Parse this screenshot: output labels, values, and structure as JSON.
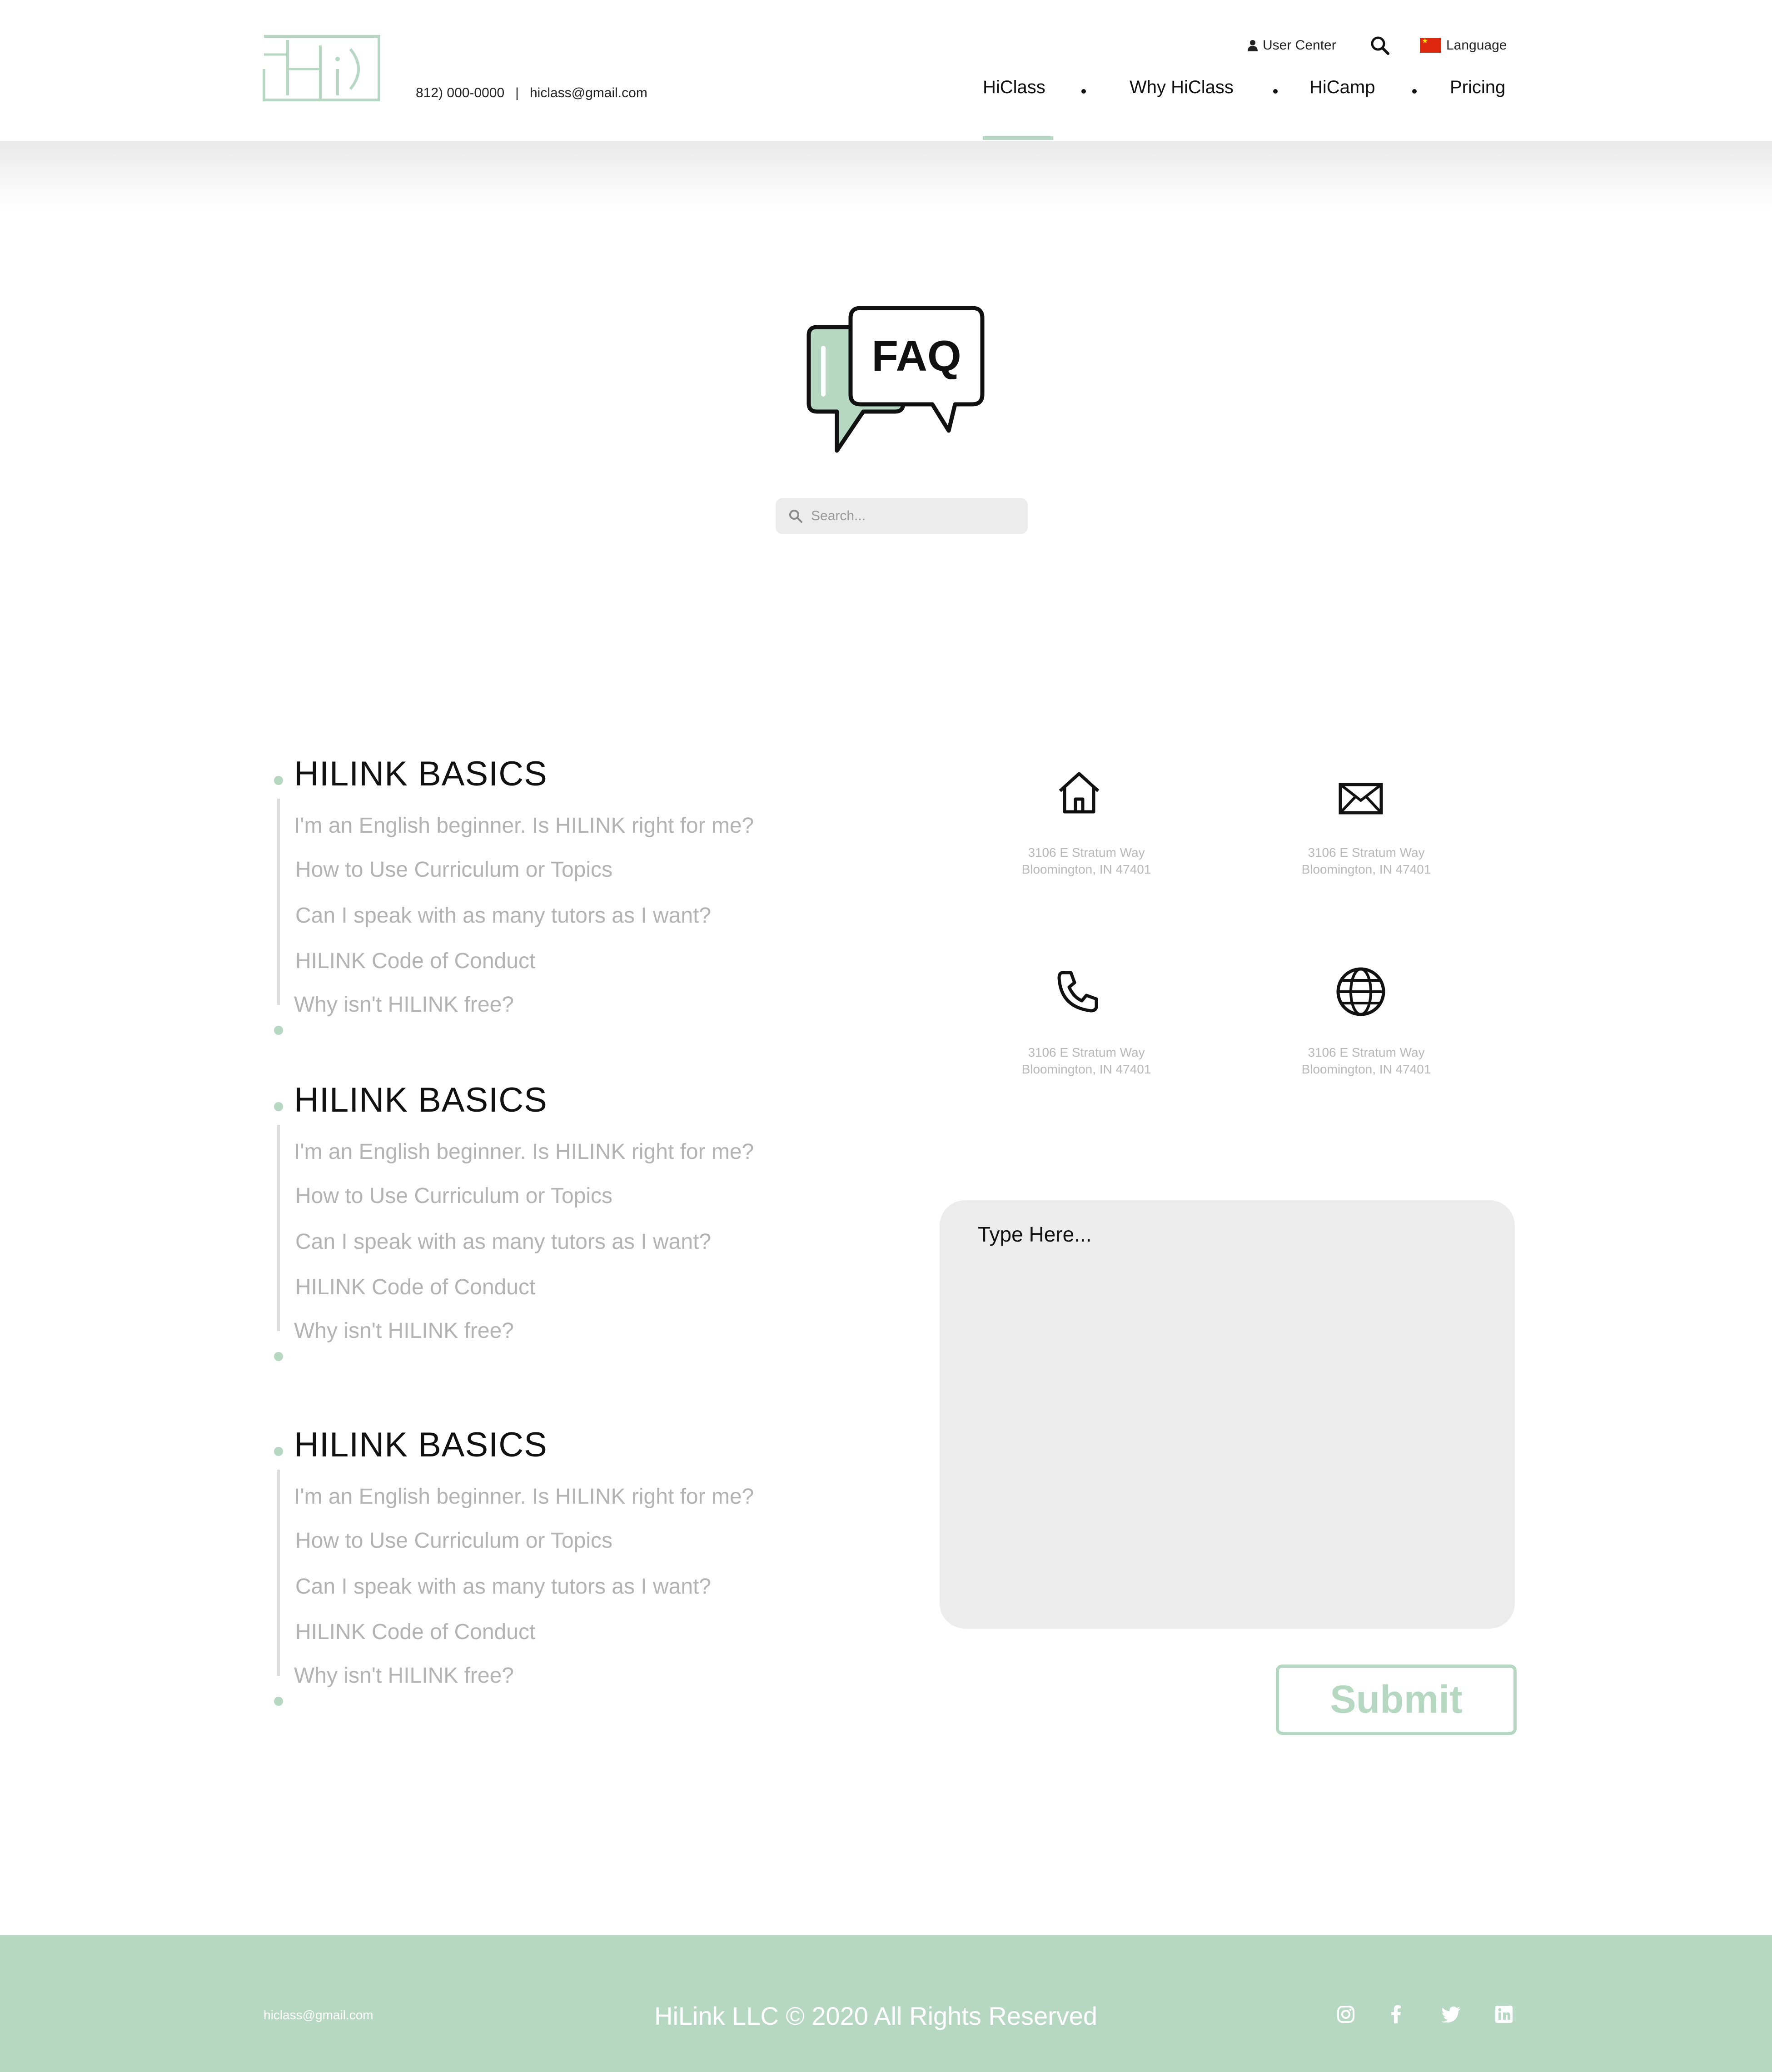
{
  "header": {
    "phone": "812) 000-0000",
    "separator": "|",
    "email": "hiclass@gmail.com",
    "user_center": "User Center",
    "language": "Language",
    "nav": [
      "HiClass",
      "Why HiClass",
      "HiCamp",
      "Pricing"
    ],
    "active_nav": "HiClass"
  },
  "hero": {
    "faq_badge": "FAQ",
    "search_placeholder": "Search..."
  },
  "faq_sections": [
    {
      "title": "HILINK BASICS",
      "questions": [
        "I'm an English beginner. Is HILINK right for me?",
        "How to Use Curriculum or Topics",
        "Can I speak with as many tutors as I want?",
        "HILINK Code of Conduct",
        "Why isn't HILINK free?"
      ]
    },
    {
      "title": "HILINK BASICS",
      "questions": [
        "I'm an English beginner. Is HILINK right for me?",
        "How to Use Curriculum or Topics",
        "Can I speak with as many tutors as I want?",
        "HILINK Code of Conduct",
        "Why isn't HILINK free?"
      ]
    },
    {
      "title": "HILINK BASICS",
      "questions": [
        "I'm an English beginner. Is HILINK right for me?",
        "How to Use Curriculum or Topics",
        "Can I speak with as many tutors as I want?",
        "HILINK Code of Conduct",
        "Why isn't HILINK free?"
      ]
    }
  ],
  "contact_info": [
    {
      "icon": "house-icon",
      "line1": "3106 E Stratum Way",
      "line2": "Bloomington, IN 47401"
    },
    {
      "icon": "envelope-icon",
      "line1": "3106 E Stratum Way",
      "line2": "Bloomington, IN 47401"
    },
    {
      "icon": "phone-icon",
      "line1": "3106 E Stratum Way",
      "line2": "Bloomington, IN 47401"
    },
    {
      "icon": "globe-icon",
      "line1": "3106 E Stratum Way",
      "line2": "Bloomington, IN 47401"
    }
  ],
  "message": {
    "placeholder": "Type Here...",
    "submit_label": "Submit"
  },
  "footer": {
    "email": "hiclass@gmail.com",
    "copyright": "HiLink LLC © 2020 All Rights Reserved",
    "social": [
      "instagram-icon",
      "facebook-icon",
      "twitter-icon",
      "linkedin-icon"
    ]
  },
  "colors": {
    "accent": "#b6d8c2",
    "muted_text": "#b3b3b3",
    "field_bg": "#ececec"
  }
}
